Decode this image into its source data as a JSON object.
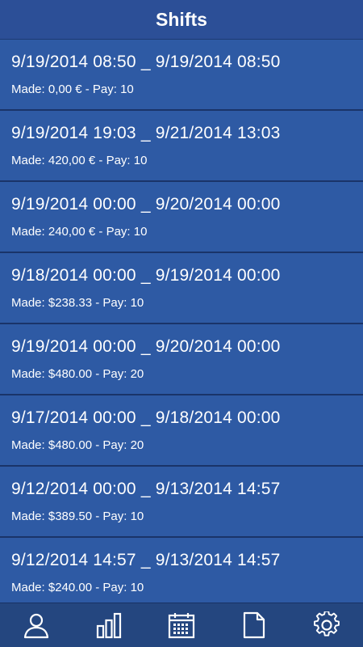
{
  "header": {
    "title": "Shifts"
  },
  "shifts": [
    {
      "range": "9/19/2014 08:50 _ 9/19/2014 08:50",
      "meta": "Made: 0,00 € - Pay: 10"
    },
    {
      "range": "9/19/2014 19:03 _ 9/21/2014 13:03",
      "meta": "Made: 420,00 € - Pay: 10"
    },
    {
      "range": "9/19/2014 00:00 _ 9/20/2014 00:00",
      "meta": "Made: 240,00 € - Pay: 10"
    },
    {
      "range": "9/18/2014 00:00 _ 9/19/2014 00:00",
      "meta": "Made: $238.33 - Pay: 10"
    },
    {
      "range": "9/19/2014 00:00 _ 9/20/2014 00:00",
      "meta": "Made: $480.00 - Pay: 20"
    },
    {
      "range": "9/17/2014 00:00 _ 9/18/2014 00:00",
      "meta": "Made: $480.00 - Pay: 20"
    },
    {
      "range": "9/12/2014 00:00 _ 9/13/2014 14:57",
      "meta": "Made: $389.50 - Pay: 10"
    },
    {
      "range": "9/12/2014 14:57 _ 9/13/2014 14:57",
      "meta": "Made: $240.00 - Pay: 10"
    }
  ],
  "tabbar": {
    "items": [
      {
        "icon": "person-icon"
      },
      {
        "icon": "bar-chart-icon"
      },
      {
        "icon": "calendar-icon"
      },
      {
        "icon": "document-icon"
      },
      {
        "icon": "gear-icon"
      }
    ]
  },
  "colors": {
    "header_bg": "#2c4f97",
    "row_bg": "#2e5aa4",
    "divider": "#1a3469",
    "tabbar_bg": "#24467f",
    "text": "#ffffff"
  }
}
